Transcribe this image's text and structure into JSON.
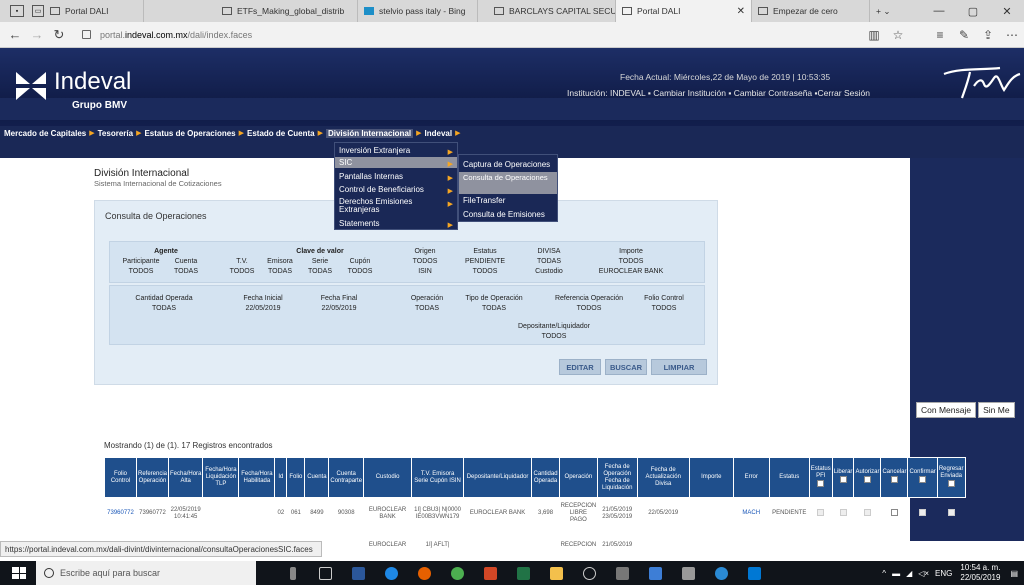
{
  "browser": {
    "tabs": [
      {
        "label": "Portal DALI",
        "active": false
      },
      {
        "label": "ETFs_Making_global_distrib",
        "active": false
      },
      {
        "label": "stelvio pass italy - Bing",
        "active": false
      },
      {
        "label": "BARCLAYS CAPITAL SECURI",
        "active": false
      },
      {
        "label": "Portal DALI",
        "active": true
      },
      {
        "label": "Empezar de cero",
        "active": false
      }
    ],
    "url_prefix": "portal.",
    "url_domain": "indeval.com.mx",
    "url_path": "/dali/index.faces"
  },
  "header": {
    "brand": "Indeval",
    "brand_sub": "Grupo BMV",
    "date": "Fecha Actual: Miércoles,22 de Mayo de 2019 | 10:53:35",
    "institution_label": "Institución:",
    "institution_value": "INDEVAL",
    "links": [
      "Cambiar Institución",
      "Cambiar Contraseña",
      "Cerrar Sesión"
    ]
  },
  "menu": [
    "Mercado de Capitales",
    "Tesorería",
    "Estatus de Operaciones",
    "Estado de Cuenta",
    "División Internacional",
    "Indeval"
  ],
  "dropdown": {
    "items": [
      {
        "label": "Inversión Extranjera"
      },
      {
        "label": "SIC"
      },
      {
        "label": "Pantallas Internas"
      },
      {
        "label": "Control de Beneficiarios"
      },
      {
        "label": "Derechos Emisiones Extranjeras"
      },
      {
        "label": "Statements"
      }
    ],
    "submenu": [
      "Captura de Operaciones",
      "Consulta de Operaciones",
      "FileTransfer",
      "Consulta de Emisiones"
    ]
  },
  "page": {
    "title": "División Internacional",
    "subtitle": "Sistema Internacional de Cotizaciones",
    "panel_title": "Consulta de Operaciones"
  },
  "filters": {
    "agente": "Agente",
    "participante_l": "Participante",
    "participante_v": "TODOS",
    "cuenta_l": "Cuenta",
    "cuenta_v": "TODAS",
    "clave": "Clave de valor",
    "tv_l": "T.V.",
    "tv_v": "TODOS",
    "emisora_l": "Emisora",
    "emisora_v": "TODAS",
    "serie_l": "Serie",
    "serie_v": "TODAS",
    "cupon_l": "Cupón",
    "cupon_v": "TODOS",
    "origen_l": "Origen",
    "origen_v": "TODOS",
    "isin_l": "ISIN",
    "isin_v": "TODOS",
    "estatus_l": "Estatus",
    "estatus_v": "PENDIENTE",
    "divisa_l": "DIVISA",
    "divisa_v": "TODAS",
    "custodio_l": "Custodio",
    "importe_l": "Importe",
    "importe_v": "TODOS",
    "custodio_v": "EUROCLEAR BANK",
    "cantidad_l": "Cantidad Operada",
    "cantidad_v": "TODAS",
    "finicial_l": "Fecha Inicial",
    "finicial_v": "22/05/2019",
    "ffinal_l": "Fecha Final",
    "ffinal_v": "22/05/2019",
    "operacion_l": "Operación",
    "operacion_v": "TODAS",
    "tipo_l": "Tipo de Operación",
    "tipo_v": "TODAS",
    "ref_l": "Referencia Operación",
    "ref_v": "TODOS",
    "folio_l": "Folio Control",
    "folio_v": "TODOS",
    "dep_l": "Depositante/Liquidador",
    "dep_v": "TODOS"
  },
  "buttons": {
    "editar": "EDITAR",
    "buscar": "BUSCAR",
    "limpiar": "LIMPIAR",
    "con_mensaje": "Con Mensaje",
    "sin_mensaje": "Sin Me"
  },
  "results": {
    "count": "Mostrando (1) de (1).  17 Registros encontrados",
    "headers": [
      "Folio Control",
      "Referencia Operación",
      "Fecha/Hora Alta",
      "Fecha/Hora Liquidación TLP",
      "Fecha/Hora Habilitada",
      "Id",
      "Folio",
      "Cuenta",
      "Cuenta Contraparte",
      "Custodio",
      "T.V. Emisora Serie Cupón ISIN",
      "Depositante/Liquidador",
      "Cantidad Operada",
      "Operación",
      "Fecha de Operación Fecha de Liquidación",
      "Fecha de Actualización Divisa",
      "Importe",
      "Error",
      "Estatus",
      "Estatus PFI",
      "Liberar",
      "Autorizar",
      "Cancelar",
      "Confirmar",
      "Regresar Enviada"
    ],
    "rows": [
      [
        "73960772",
        "73960772",
        "22/05/2019 10:41:45",
        "",
        "",
        "02",
        "061",
        "8499",
        "90308",
        "EUROCLEAR BANK",
        "1I] CBU3| N|0000 IE00B3VWN179",
        "EUROCLEAR BANK",
        "3,698",
        "RECEPCION LIBRE PAGO",
        "21/05/2019 23/05/2019",
        "22/05/2019",
        "",
        "MACH",
        "PENDIENTE"
      ],
      [
        "",
        "",
        "",
        "",
        "",
        "",
        "",
        "",
        "",
        "EUROCLEAR",
        "1I] AFLT|",
        "",
        "",
        "RECEPCION",
        "21/05/2019",
        "",
        "",
        "",
        ""
      ]
    ]
  },
  "statusbar": "https://portal.indeval.com.mx/dali-divint/divinternacional/consultaOperacionesSIC.faces",
  "taskbar": {
    "search": "Escribe aquí para buscar",
    "lang": "ENG",
    "time": "10:54 a. m.",
    "date": "22/05/2019"
  }
}
